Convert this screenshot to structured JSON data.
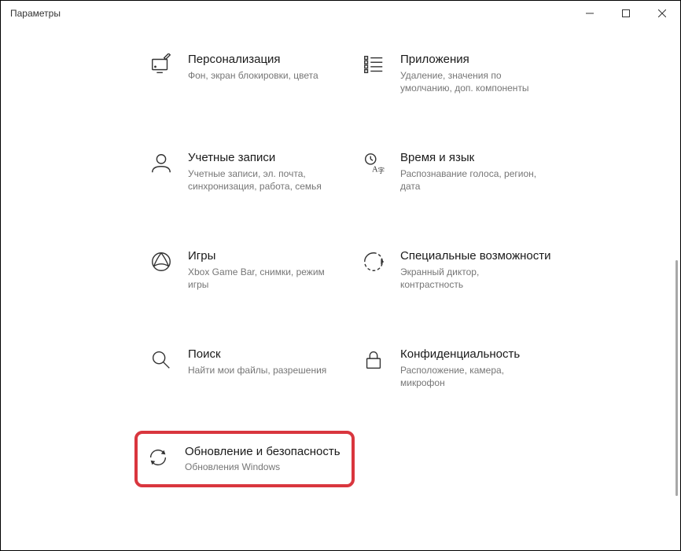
{
  "window": {
    "title": "Параметры"
  },
  "tiles": {
    "personalization": {
      "title": "Персонализация",
      "desc": "Фон, экран блокировки, цвета"
    },
    "apps": {
      "title": "Приложения",
      "desc": "Удаление, значения по умолчанию, доп. компоненты"
    },
    "accounts": {
      "title": "Учетные записи",
      "desc": "Учетные записи, эл. почта, синхронизация, работа, семья"
    },
    "time": {
      "title": "Время и язык",
      "desc": "Распознавание голоса, регион, дата"
    },
    "gaming": {
      "title": "Игры",
      "desc": "Xbox Game Bar, снимки, режим игры"
    },
    "accessibility": {
      "title": "Специальные возможности",
      "desc": "Экранный диктор, контрастность"
    },
    "search": {
      "title": "Поиск",
      "desc": "Найти мои файлы, разрешения"
    },
    "privacy": {
      "title": "Конфиденциальность",
      "desc": "Расположение, камера, микрофон"
    },
    "update": {
      "title": "Обновление и безопасность",
      "desc": "Обновления Windows"
    }
  }
}
